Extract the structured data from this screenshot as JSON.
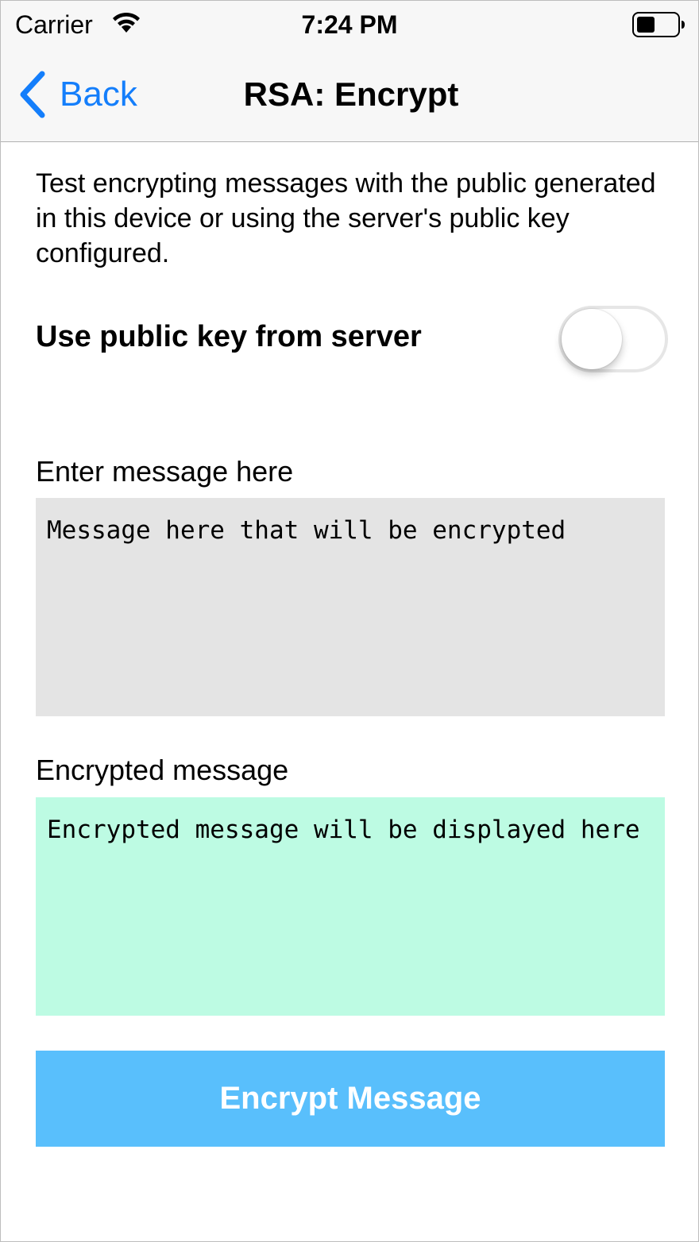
{
  "status_bar": {
    "carrier": "Carrier",
    "time": "7:24 PM",
    "wifi_icon": "wifi-icon",
    "battery_icon": "battery-icon"
  },
  "nav": {
    "back_label": "Back",
    "title": "RSA: Encrypt",
    "accent_color": "#147efb"
  },
  "content": {
    "description": "Test encrypting messages with the public generated in this device or using the server's public key configured.",
    "toggle": {
      "label": "Use public key from server",
      "on": false
    },
    "input": {
      "label": "Enter message here",
      "value": "Message here that will be encrypted",
      "background": "#e4e4e4"
    },
    "output": {
      "label": "Encrypted message",
      "value": "Encrypted message will be displayed here",
      "background": "#bdfbe3"
    },
    "encrypt_button": {
      "label": "Encrypt Message",
      "background": "#59bffc"
    }
  }
}
